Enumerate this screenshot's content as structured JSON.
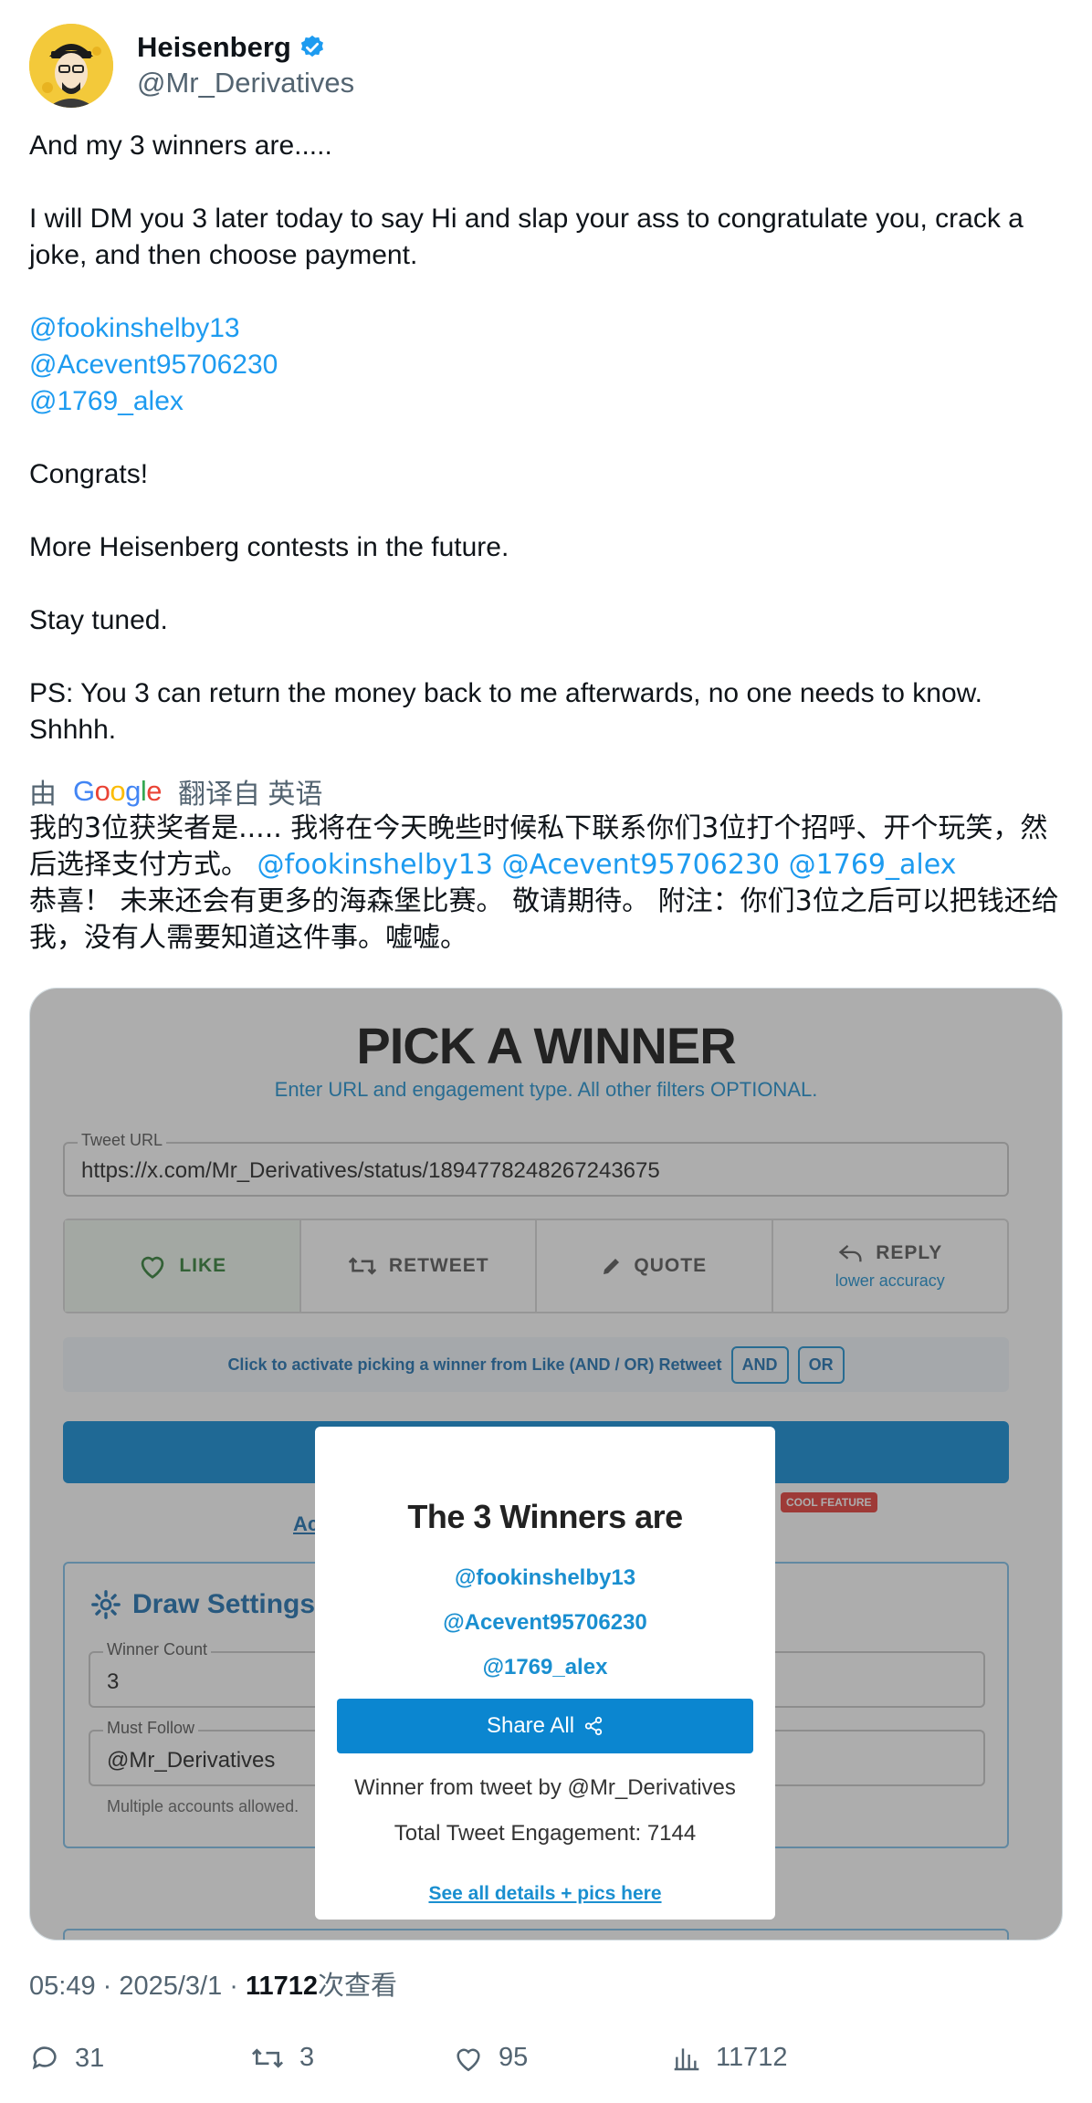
{
  "author": {
    "display_name": "Heisenberg",
    "handle": "@Mr_Derivatives",
    "verified_icon": "verified-badge-icon",
    "avatar_icon": "heisenberg-avatar-icon"
  },
  "tweet": {
    "line1": "And my 3 winners are.....",
    "line2": "I will DM you 3 later today to say Hi and slap your ass to congratulate you, crack a joke, and then choose payment.",
    "mentions": [
      "@fookinshelby13",
      "@Acevent95706230",
      "@1769_alex"
    ],
    "congrats": "Congrats!",
    "more": "More Heisenberg contests in the future.",
    "stay": "Stay tuned.",
    "ps": "PS: You 3 can return the money back to me afterwards, no one needs to know. Shhhh."
  },
  "translation": {
    "prefix": "由",
    "google": "Google",
    "suffix": "翻译自 英语",
    "text_a": "我的3位获奖者是..... 我将在今天晚些时候私下联系你们3位打个招呼、开个玩笑，然后选择支付方式。 ",
    "mentions": "@fookinshelby13 @Acevent95706230 @1769_alex",
    "text_b": "恭喜！ 未来还会有更多的海森堡比赛。 敬请期待。 附注：你们3位之后可以把钱还给我，没有人需要知道这件事。嘘嘘。"
  },
  "media": {
    "title": "PICK A WINNER",
    "subtitle": "Enter URL and engagement type. All other filters OPTIONAL.",
    "url_label": "Tweet URL",
    "url_value": "https://x.com/Mr_Derivatives/status/1894778248267243675",
    "engagement": [
      {
        "label": "LIKE",
        "icon": "heart-icon",
        "note": ""
      },
      {
        "label": "RETWEET",
        "icon": "retweet-icon",
        "note": ""
      },
      {
        "label": "QUOTE",
        "icon": "pencil-icon",
        "note": ""
      },
      {
        "label": "REPLY",
        "icon": "reply-icon",
        "note": "lower accuracy"
      }
    ],
    "and_or_text": "Click to activate picking a winner from Like (AND / OR) Retweet",
    "and_label": "AND",
    "or_label": "OR",
    "cool_badge": "COOL FEATURE",
    "ac_link": "Ac",
    "draw_settings": "Draw Settings",
    "winner_count_label": "Winner Count",
    "winner_count_value": "3",
    "must_follow_label": "Must Follow",
    "must_follow_value": "@Mr_Derivatives",
    "help_text": "Multiple accounts allowed.",
    "modal": {
      "title": "The 3 Winners are",
      "winners": [
        "@fookinshelby13",
        "@Acevent95706230",
        "@1769_alex"
      ],
      "share_label": "Share All",
      "from_line": "Winner from tweet by @Mr_Derivatives",
      "engagement_line": "Total Tweet Engagement: 7144",
      "details_link": "See all details + pics here"
    }
  },
  "meta": {
    "time": "05:49 · 2025/3/1 · ",
    "views_count": "11712",
    "views_suffix": "次查看"
  },
  "actions": {
    "replies": "31",
    "reposts": "3",
    "likes": "95",
    "views": "11712"
  }
}
